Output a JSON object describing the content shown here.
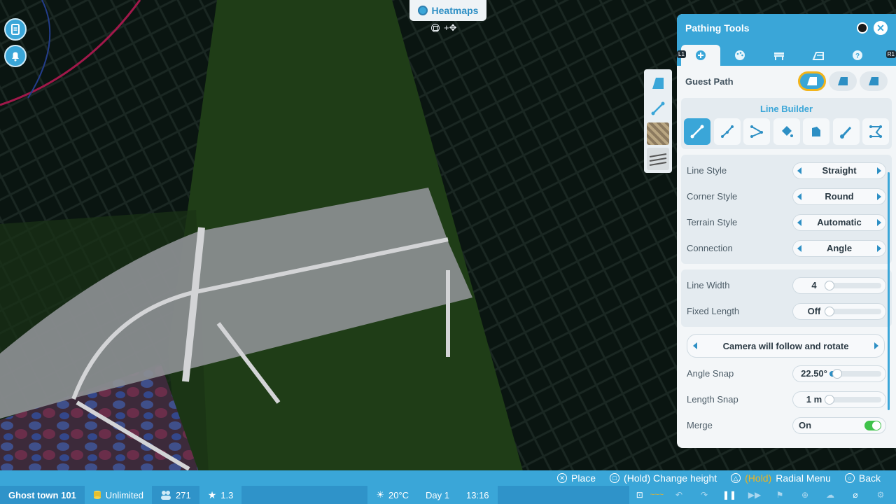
{
  "heatmaps": {
    "label": "Heatmaps",
    "hint": "+✥"
  },
  "side": {
    "buttons": [
      "clipboard-icon",
      "bell-icon"
    ]
  },
  "mid_tools": [
    "path-surface-icon",
    "line-builder-icon",
    "texture-swatch",
    "railing-swatch"
  ],
  "panel": {
    "title": "Pathing Tools",
    "tabs": [
      "plus-icon",
      "palette-icon",
      "bench-icon",
      "queue-icon",
      "help-icon"
    ],
    "tab_l": "L1",
    "tab_r": "R1",
    "guest_path": "Guest Path",
    "line_builder": "Line Builder",
    "options": [
      {
        "label": "Line Style",
        "value": "Straight"
      },
      {
        "label": "Corner Style",
        "value": "Round"
      },
      {
        "label": "Terrain Style",
        "value": "Automatic"
      },
      {
        "label": "Connection",
        "value": "Angle"
      }
    ],
    "line_width": {
      "label": "Line Width",
      "value": "4",
      "level": 0
    },
    "fixed_length": {
      "label": "Fixed Length",
      "value": "Off",
      "level": 0
    },
    "camera": "Camera will follow and rotate",
    "angle_snap": {
      "label": "Angle Snap",
      "value": "22.50°",
      "level": 0.15
    },
    "length_snap": {
      "label": "Length Snap",
      "value": "1 m",
      "level": 0
    },
    "merge": {
      "label": "Merge",
      "value": "On"
    }
  },
  "hints": [
    {
      "btn": "✕",
      "hold": "",
      "label": "Place"
    },
    {
      "btn": "□",
      "hold": "",
      "label": "(Hold) Change height"
    },
    {
      "btn": "△",
      "hold": "(Hold)",
      "label": "Radial Menu"
    },
    {
      "btn": "○",
      "hold": "",
      "label": "Back"
    }
  ],
  "status": {
    "park": "Ghost town 101",
    "money": "Unlimited",
    "guests": "271",
    "rating": "1.3",
    "temperature": "20°C",
    "day": "Day 1",
    "time": "13:16"
  }
}
